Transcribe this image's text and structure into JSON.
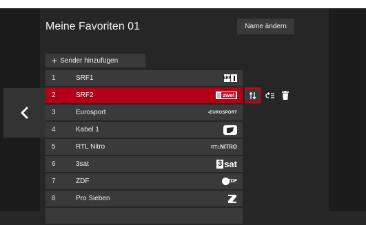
{
  "title": "Meine Favoriten 01",
  "rename_label": "Name ändern",
  "add_label": "Sender hinzufügen",
  "channels": [
    {
      "num": "1",
      "name": "SRF1"
    },
    {
      "num": "2",
      "name": "SRF2"
    },
    {
      "num": "3",
      "name": "Eurosport"
    },
    {
      "num": "4",
      "name": "Kabel 1"
    },
    {
      "num": "5",
      "name": "RTL Nitro"
    },
    {
      "num": "6",
      "name": "3sat"
    },
    {
      "num": "7",
      "name": "ZDF"
    },
    {
      "num": "8",
      "name": "Pro Sieben"
    }
  ],
  "logos": {
    "srf1_text": "SRF",
    "srf2_text": "zwei",
    "eurosport_text": "▪EUROSPORT",
    "rtl_text_a": "RTL",
    "rtl_text_b": "NITRO",
    "sat_text_a": "3",
    "sat_text_b": "sat",
    "zdf_text": "ZDF"
  },
  "icons": {
    "back": "chevron-left-icon",
    "add": "plus-icon",
    "move": "sort-arrows-icon",
    "reorder": "list-insert-icon",
    "delete": "trash-icon"
  },
  "colors": {
    "selected_row": "#b30017",
    "focus_border": "#d10019"
  },
  "selected_index": 1
}
